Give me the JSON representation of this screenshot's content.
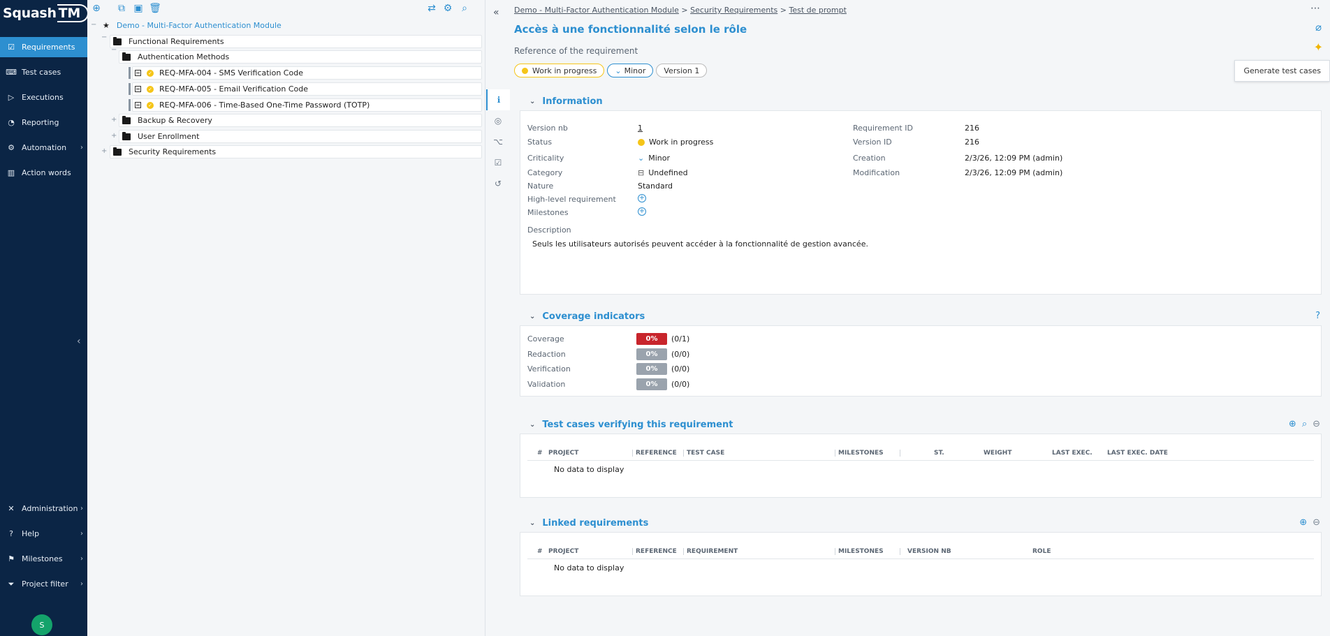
{
  "app": {
    "logo": "SquashTM"
  },
  "sidebar": {
    "items": [
      {
        "label": "Requirements",
        "icon": "requirements-icon"
      },
      {
        "label": "Test cases",
        "icon": "test-cases-icon"
      },
      {
        "label": "Executions",
        "icon": "executions-icon"
      },
      {
        "label": "Reporting",
        "icon": "reporting-icon"
      },
      {
        "label": "Automation",
        "icon": "automation-icon"
      },
      {
        "label": "Action words",
        "icon": "action-words-icon"
      }
    ],
    "bottom_items": [
      {
        "label": "Administration",
        "icon": "administration-icon"
      },
      {
        "label": "Help",
        "icon": "help-icon"
      },
      {
        "label": "Milestones",
        "icon": "milestones-icon"
      },
      {
        "label": "Project filter",
        "icon": "project-filter-icon"
      }
    ],
    "avatar_initial": "S"
  },
  "tree": {
    "project": "Demo - Multi-Factor Authentication Module",
    "functional": "Functional Requirements",
    "auth_methods": "Authentication Methods",
    "reqs": [
      "REQ-MFA-004 - SMS Verification Code",
      "REQ-MFA-005 - Email Verification Code",
      "REQ-MFA-006 - Time-Based One-Time Password (TOTP)"
    ],
    "backup": "Backup & Recovery",
    "enrollment": "User Enrollment",
    "security": "Security Requirements"
  },
  "header": {
    "breadcrumb": [
      "Demo - Multi-Factor Authentication Module",
      "Security Requirements",
      "Test de prompt"
    ],
    "title": "Accès à une fonctionnalité selon le rôle",
    "reference": "Reference of the requirement",
    "badges": {
      "status": "Work in progress",
      "criticality": "Minor",
      "version": "Version 1"
    },
    "tooltip": "Generate test cases"
  },
  "information": {
    "title": "Information",
    "version_nb_label": "Version nb",
    "version_nb": "1",
    "status_label": "Status",
    "status": "Work in progress",
    "criticality_label": "Criticality",
    "criticality": "Minor",
    "category_label": "Category",
    "category": "Undefined",
    "nature_label": "Nature",
    "nature": "Standard",
    "high_level_label": "High-level requirement",
    "milestones_label": "Milestones",
    "req_id_label": "Requirement ID",
    "req_id": "216",
    "version_id_label": "Version ID",
    "version_id": "216",
    "creation_label": "Creation",
    "creation": "2/3/26, 12:09 PM (admin)",
    "modification_label": "Modification",
    "modification": "2/3/26, 12:09 PM (admin)",
    "description_label": "Description",
    "description": "Seuls les utilisateurs autorisés peuvent accéder à la fonctionnalité de gestion avancée."
  },
  "coverage": {
    "title": "Coverage indicators",
    "rows": [
      {
        "label": "Coverage",
        "pct": "0%",
        "ratio": "(0/1)",
        "color": "#c8252c"
      },
      {
        "label": "Redaction",
        "pct": "0%",
        "ratio": "(0/0)",
        "color": "#9aa3ad"
      },
      {
        "label": "Verification",
        "pct": "0%",
        "ratio": "(0/0)",
        "color": "#9aa3ad"
      },
      {
        "label": "Validation",
        "pct": "0%",
        "ratio": "(0/0)",
        "color": "#9aa3ad"
      }
    ]
  },
  "test_cases": {
    "title": "Test cases verifying this requirement",
    "columns": [
      "#",
      "PROJECT",
      "REFERENCE",
      "TEST CASE",
      "MILESTONES",
      "ST.",
      "WEIGHT",
      "LAST EXEC.",
      "LAST EXEC. DATE"
    ],
    "empty": "No data to display"
  },
  "linked": {
    "title": "Linked requirements",
    "columns": [
      "#",
      "PROJECT",
      "REFERENCE",
      "REQUIREMENT",
      "MILESTONES",
      "VERSION NB",
      "ROLE"
    ],
    "empty": "No data to display"
  },
  "colors": {
    "accent": "#2d8fd0",
    "sidebar": "#0b2545",
    "wip": "#f5c518"
  }
}
